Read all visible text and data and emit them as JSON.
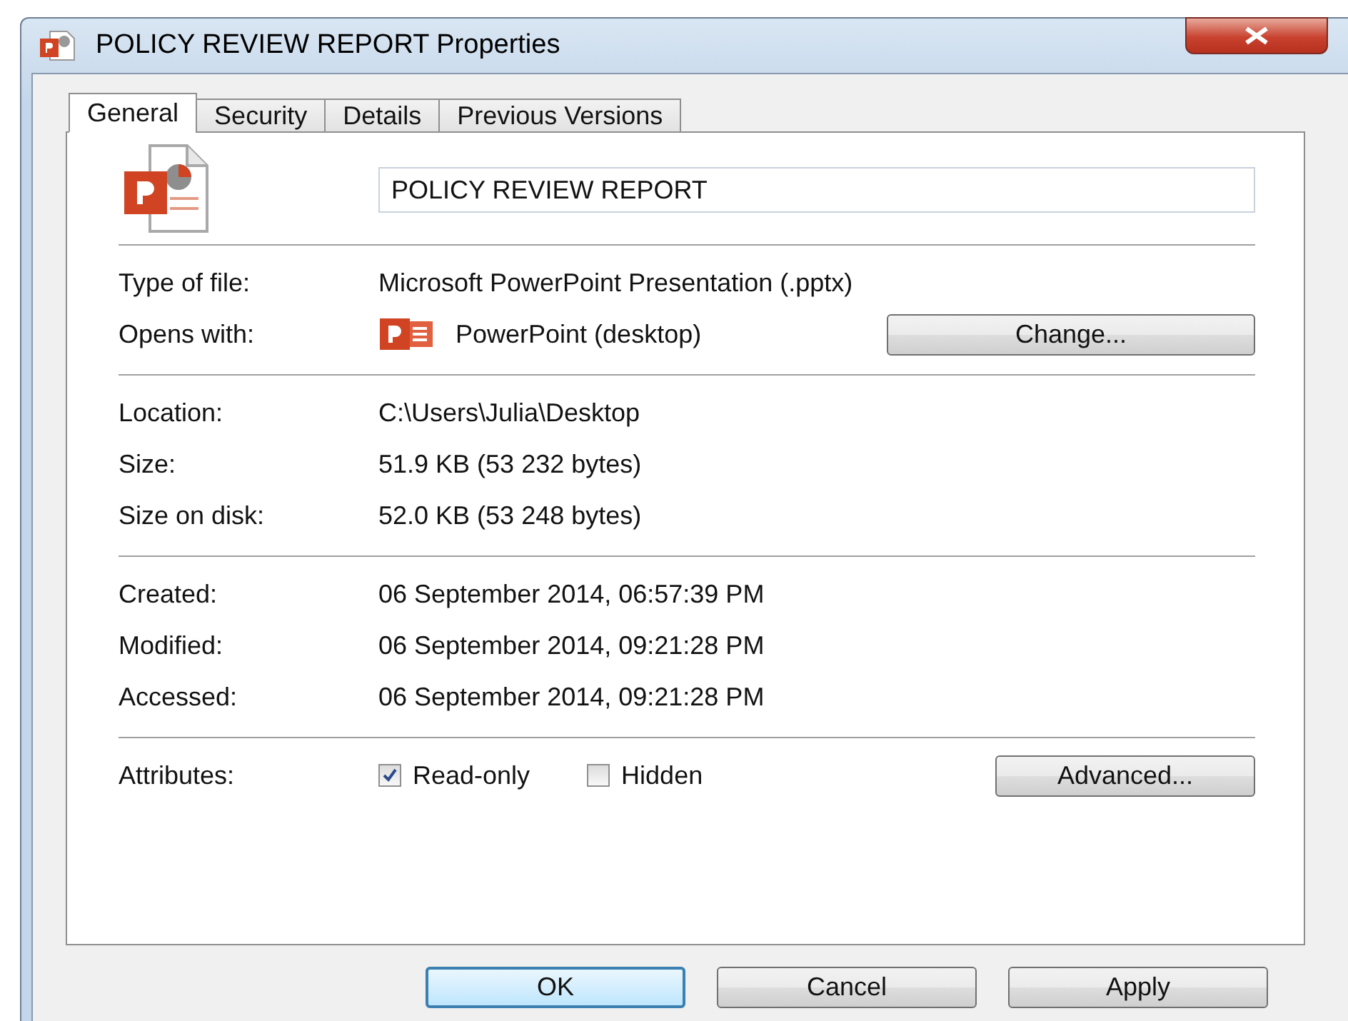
{
  "window": {
    "title": "POLICY REVIEW REPORT Properties"
  },
  "tabs": [
    {
      "label": "General",
      "selected": true
    },
    {
      "label": "Security",
      "selected": false
    },
    {
      "label": "Details",
      "selected": false
    },
    {
      "label": "Previous Versions",
      "selected": false
    }
  ],
  "file_name": {
    "value": "POLICY REVIEW REPORT"
  },
  "groups": [
    {
      "rows": [
        {
          "kind": "text",
          "label": "Type of file:",
          "value": "Microsoft PowerPoint Presentation (.pptx)"
        },
        {
          "kind": "app",
          "label": "Opens with:",
          "value": "PowerPoint (desktop)",
          "button": "Change..."
        }
      ]
    },
    {
      "rows": [
        {
          "kind": "text",
          "label": "Location:",
          "value": "C:\\Users\\Julia\\Desktop"
        },
        {
          "kind": "text",
          "label": "Size:",
          "value": "51.9 KB (53 232 bytes)"
        },
        {
          "kind": "text",
          "label": "Size on disk:",
          "value": "52.0 KB (53 248 bytes)"
        }
      ]
    },
    {
      "rows": [
        {
          "kind": "text",
          "label": "Created:",
          "value": "06 September 2014, 06:57:39 PM"
        },
        {
          "kind": "text",
          "label": "Modified:",
          "value": "06 September 2014, 09:21:28 PM"
        },
        {
          "kind": "text",
          "label": "Accessed:",
          "value": "06 September 2014, 09:21:28 PM"
        }
      ]
    }
  ],
  "attributes": {
    "label": "Attributes:",
    "options": [
      {
        "label": "Read-only",
        "checked": true
      },
      {
        "label": "Hidden",
        "checked": false
      }
    ],
    "button": "Advanced..."
  },
  "buttons": [
    {
      "label": "OK",
      "default": true
    },
    {
      "label": "Cancel",
      "default": false
    },
    {
      "label": "Apply",
      "default": false
    }
  ]
}
